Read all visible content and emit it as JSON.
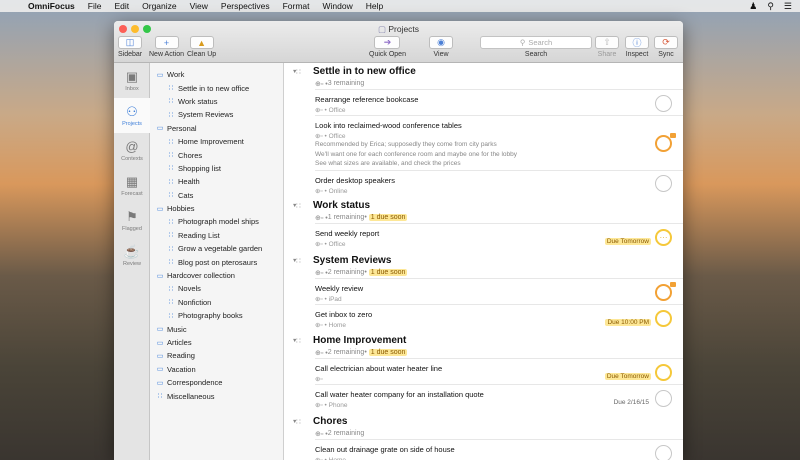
{
  "menubar": {
    "apple": "",
    "app": "OmniFocus",
    "items": [
      "File",
      "Edit",
      "Organize",
      "View",
      "Perspectives",
      "Format",
      "Window",
      "Help"
    ]
  },
  "window": {
    "title": "Projects"
  },
  "toolbar": {
    "sidebar": "Sidebar",
    "new_action": "New Action",
    "clean_up": "Clean Up",
    "quick_open": "Quick Open",
    "view": "View",
    "search_label": "Search",
    "search_placeholder": "Search",
    "share": "Share",
    "inspect": "Inspect",
    "sync": "Sync"
  },
  "rail": [
    {
      "label": "Inbox",
      "icon": "inbox-icon"
    },
    {
      "label": "Projects",
      "icon": "projects-icon"
    },
    {
      "label": "Contexts",
      "icon": "contexts-icon"
    },
    {
      "label": "Forecast",
      "icon": "forecast-icon"
    },
    {
      "label": "Flagged",
      "icon": "flag-icon"
    },
    {
      "label": "Review",
      "icon": "review-icon"
    }
  ],
  "sidebar": [
    {
      "label": "Work",
      "type": "folder",
      "level": 0
    },
    {
      "label": "Settle in to new office",
      "type": "project",
      "level": 1
    },
    {
      "label": "Work status",
      "type": "project",
      "level": 1
    },
    {
      "label": "System Reviews",
      "type": "project",
      "level": 1
    },
    {
      "label": "Personal",
      "type": "folder",
      "level": 0
    },
    {
      "label": "Home Improvement",
      "type": "project",
      "level": 1
    },
    {
      "label": "Chores",
      "type": "project",
      "level": 1
    },
    {
      "label": "Shopping list",
      "type": "project",
      "level": 1
    },
    {
      "label": "Health",
      "type": "project",
      "level": 1
    },
    {
      "label": "Cats",
      "type": "project",
      "level": 1
    },
    {
      "label": "Hobbies",
      "type": "folder",
      "level": 0
    },
    {
      "label": "Photograph model ships",
      "type": "project",
      "level": 1
    },
    {
      "label": "Reading List",
      "type": "project",
      "level": 1
    },
    {
      "label": "Grow a vegetable garden",
      "type": "project",
      "level": 1
    },
    {
      "label": "Blog post on pterosaurs",
      "type": "project",
      "level": 1
    },
    {
      "label": "Hardcover collection",
      "type": "folder",
      "level": 0
    },
    {
      "label": "Novels",
      "type": "project",
      "level": 1
    },
    {
      "label": "Nonfiction",
      "type": "project",
      "level": 1
    },
    {
      "label": "Photography books",
      "type": "project",
      "level": 1
    },
    {
      "label": "Music",
      "type": "folder",
      "level": 0
    },
    {
      "label": "Articles",
      "type": "folder",
      "level": 0
    },
    {
      "label": "Reading",
      "type": "folder",
      "level": 0
    },
    {
      "label": "Vacation",
      "type": "folder",
      "level": 0
    },
    {
      "label": "Correspondence",
      "type": "folder",
      "level": 0
    },
    {
      "label": "Miscellaneous",
      "type": "project",
      "level": 0
    }
  ],
  "groups": [
    {
      "title": "Settle in to new office",
      "remaining": "3 remaining",
      "due_soon": "",
      "tasks": [
        {
          "title": "Rearrange reference bookcase",
          "context": "Office"
        },
        {
          "title": "Look into reclaimed-wood conference tables",
          "context": "Office",
          "flagged": true,
          "note": [
            "Recommended by Erica; supposedly they come from city parks",
            "We'll want one for each conference room and maybe one for the lobby",
            "See what sizes are available, and check the prices"
          ]
        },
        {
          "title": "Order desktop speakers",
          "context": "Online"
        }
      ]
    },
    {
      "title": "Work status",
      "remaining": "1 remaining",
      "due_soon": "1 due soon",
      "tasks": [
        {
          "title": "Send weekly report",
          "context": "Office",
          "due": "Due Tomorrow"
        }
      ]
    },
    {
      "title": "System Reviews",
      "remaining": "2 remaining",
      "due_soon": "1 due soon",
      "tasks": [
        {
          "title": "Weekly review",
          "context": "iPad",
          "flagged": true
        },
        {
          "title": "Get inbox to zero",
          "context": "Home",
          "due": "Due 10:00 PM"
        }
      ]
    },
    {
      "title": "Home Improvement",
      "remaining": "2 remaining",
      "due_soon": "1 due soon",
      "tasks": [
        {
          "title": "Call electrician about water heater line",
          "context": "",
          "due": "Due Tomorrow"
        },
        {
          "title": "Call water heater company for an installation quote",
          "context": "Phone",
          "due": "Due 2/16/15"
        }
      ]
    },
    {
      "title": "Chores",
      "remaining": "2 remaining",
      "due_soon": "",
      "tasks": [
        {
          "title": "Clean out drainage grate on side of house",
          "context": "Home"
        }
      ]
    }
  ]
}
